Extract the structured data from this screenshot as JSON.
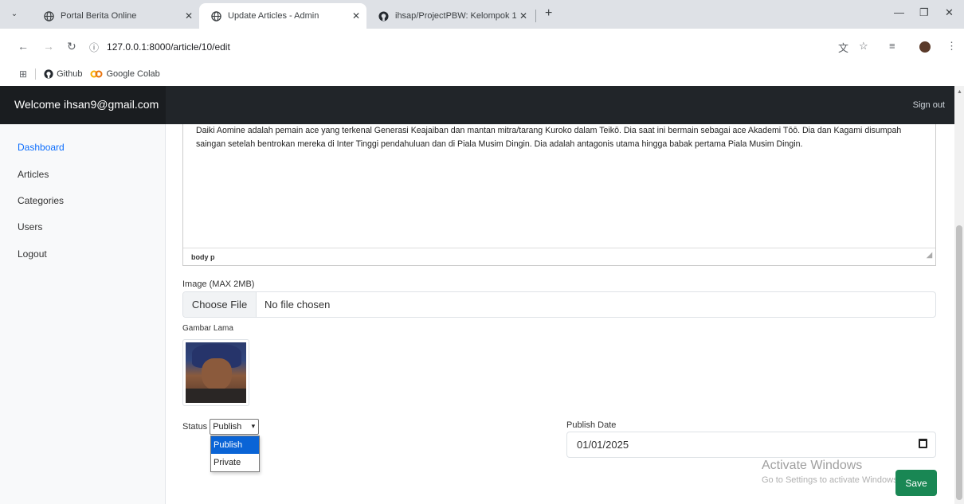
{
  "browser": {
    "tabs": [
      {
        "title": "Portal Berita Online",
        "icon": "globe-icon"
      },
      {
        "title": "Update Articles - Admin",
        "icon": "globe-icon"
      },
      {
        "title": "ihsap/ProjectPBW: Kelompok 1",
        "icon": "github-icon"
      }
    ],
    "url": "127.0.0.1:8000/article/10/edit",
    "bookmarks": [
      {
        "label": "Github",
        "icon": "github-icon"
      },
      {
        "label": "Google Colab",
        "icon": "colab-icon"
      }
    ]
  },
  "navbar": {
    "brand": "Welcome ihsan9@gmail.com",
    "signout": "Sign out"
  },
  "sidebar": {
    "items": [
      {
        "label": "Dashboard"
      },
      {
        "label": "Articles"
      },
      {
        "label": "Categories"
      },
      {
        "label": "Users"
      },
      {
        "label": "Logout"
      }
    ]
  },
  "editor": {
    "content": "Daiki Aomine adalah pemain ace yang terkenal Generasi Keajaiban dan mantan mitra/tarang Kuroko dalam Teikō. Dia saat ini bermain sebagai ace Akademi Tōō. Dia dan Kagami disumpah saingan setelah bentrokan mereka di Inter Tinggi pendahuluan dan di Piala Musim Dingin. Dia adalah antagonis utama hingga babak pertama Piala Musim Dingin.",
    "statusbar": "body  p"
  },
  "form": {
    "image_label": "Image (MAX 2MB)",
    "choose_file": "Choose File",
    "no_file": "No file chosen",
    "old_image_label": "Gambar Lama",
    "status_label": "Status",
    "status_selected": "Publish",
    "status_options": [
      "Publish",
      "Private"
    ],
    "publish_date_label": "Publish Date",
    "publish_date_value": "01/01/2025",
    "save_label": "Save"
  },
  "watermark": {
    "title": "Activate Windows",
    "subtitle": "Go to Settings to activate Windows."
  }
}
